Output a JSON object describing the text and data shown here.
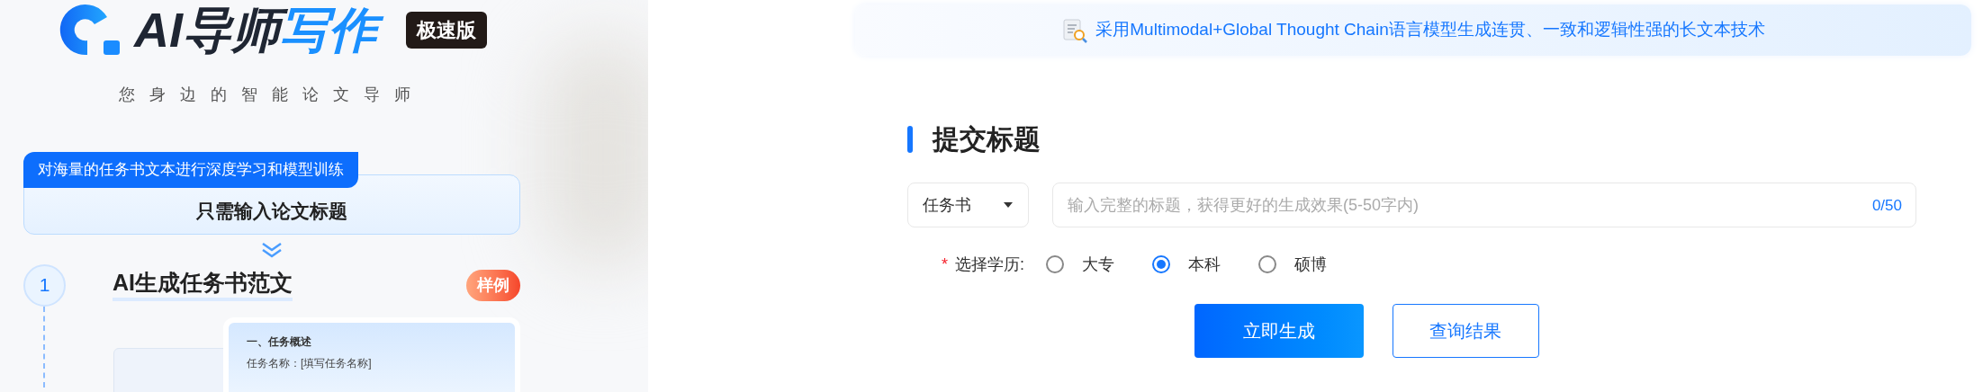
{
  "logo": {
    "text_dark": "AI导师",
    "text_accent": "写作",
    "badge": "极速版"
  },
  "tagline": "您身边的智能论文导师",
  "intro": {
    "tag": "对海量的任务书文本进行深度学习和模型训练",
    "title": "只需输入论文标题"
  },
  "step": {
    "number": "1",
    "title": "AI生成任务书范文",
    "badge": "样例"
  },
  "sample_card": {
    "heading": "一、任务概述",
    "line": "任务名称：[填写任务名称]"
  },
  "banner": "采用Multimodal+Global Thought Chain语言模型生成连贯、一致和逻辑性强的长文本技术",
  "form": {
    "heading": "提交标题",
    "doc_type": "任务书",
    "title_input": {
      "placeholder": "输入完整的标题，获得更好的生成效果(5-50字内)",
      "counter": "0/50"
    },
    "education": {
      "required_mark": "*",
      "label": "选择学历:",
      "options": [
        {
          "label": "大专",
          "selected": false
        },
        {
          "label": "本科",
          "selected": true
        },
        {
          "label": "硕博",
          "selected": false
        }
      ]
    },
    "buttons": [
      {
        "label": "立即生成",
        "kind": "primary"
      },
      {
        "label": "查询结果",
        "kind": "secondary"
      }
    ]
  }
}
